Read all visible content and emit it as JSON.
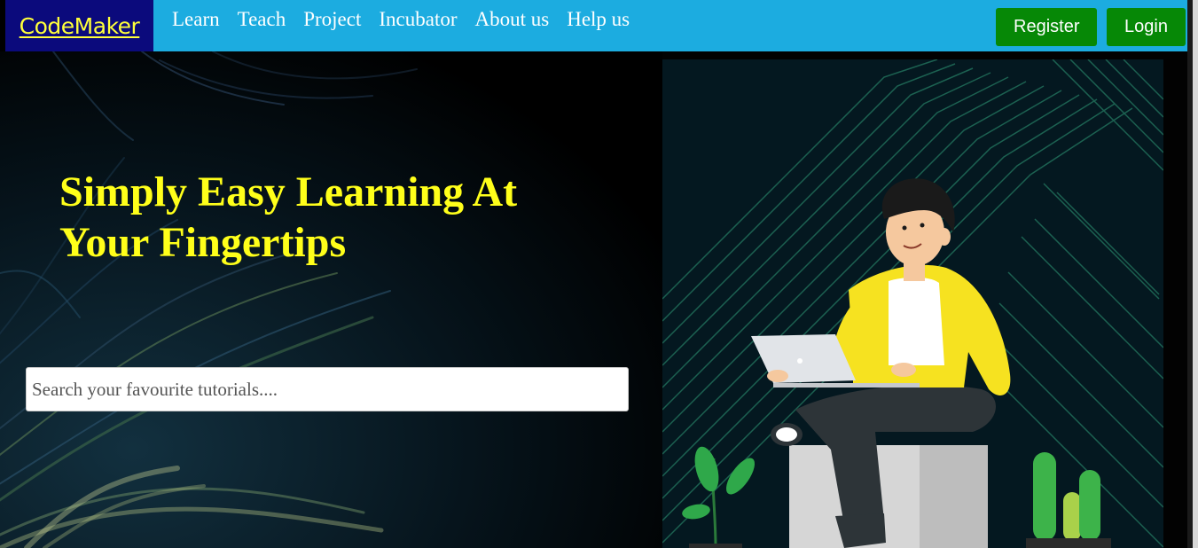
{
  "brand": {
    "name": "CodeMaker"
  },
  "nav": {
    "items": [
      {
        "label": "Learn"
      },
      {
        "label": "Teach"
      },
      {
        "label": "Project"
      },
      {
        "label": "Incubator"
      },
      {
        "label": "About us"
      },
      {
        "label": "Help us"
      }
    ]
  },
  "auth": {
    "register_label": "Register",
    "login_label": "Login"
  },
  "hero": {
    "title": "Simply Easy Learning At Your Fingertips",
    "search_placeholder": "Search your favourite tutorials...."
  },
  "colors": {
    "navbar": "#1cace0",
    "brand_bg": "#0b0a7c",
    "brand_text": "#ffff3a",
    "button": "#068806",
    "hero_title": "#ffff1a",
    "shirt": "#f6e220"
  },
  "icons": {
    "illustration": "person-with-laptop-illustration"
  }
}
